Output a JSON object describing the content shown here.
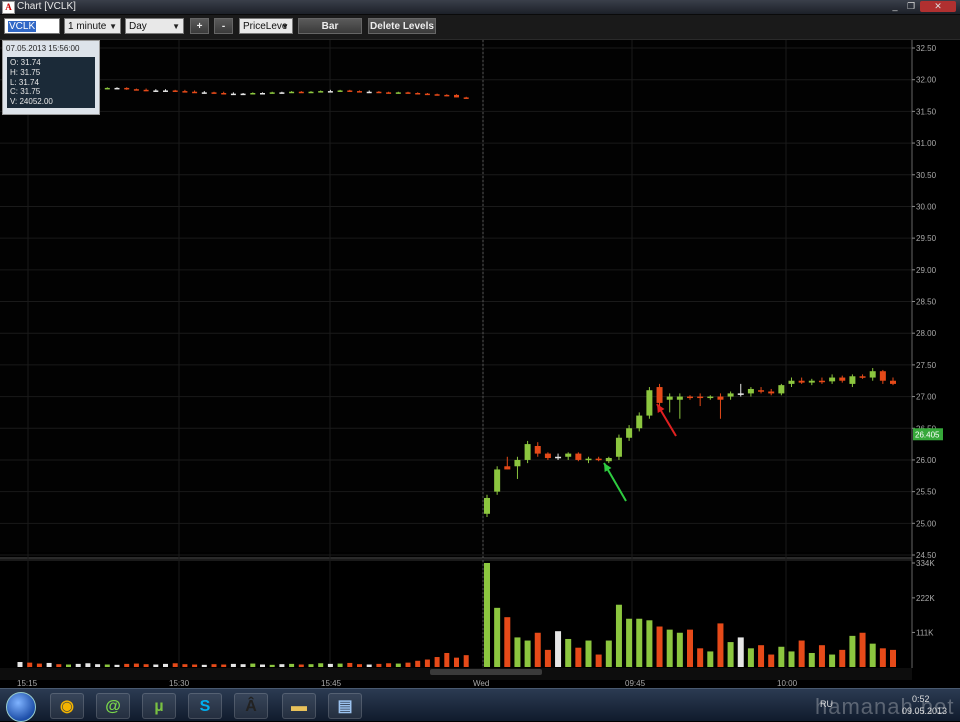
{
  "window": {
    "title": "Chart [VCLK]",
    "minimize": "_",
    "restore": "❐",
    "close": "✕"
  },
  "toolbar": {
    "symbol": "VCLK",
    "interval": "1 minute",
    "period": "Day",
    "zoom_in": "+",
    "zoom_out": "-",
    "study": "PriceLeve",
    "bar_button": "Bar",
    "delete_levels_button": "Delete Levels"
  },
  "ohlc_panel": {
    "timestamp": "07.05.2013 15:56:00",
    "open": "O: 31.74",
    "high": "H: 31.75",
    "low": "L: 31.74",
    "close": "C: 31.75",
    "volume": "V: 24052.00"
  },
  "colors": {
    "up": "#8cc63f",
    "down": "#e64a19",
    "neutral": "#e6e6e6",
    "last_price_bg": "#36a83a",
    "grid": "#1a1a1a"
  },
  "chart_data": {
    "type": "candlestick",
    "price_axis": {
      "range": [
        24.5,
        32.5
      ],
      "ticks": [
        "32.50",
        "32.00",
        "31.50",
        "31.00",
        "30.50",
        "30.00",
        "29.50",
        "29.00",
        "28.50",
        "28.00",
        "27.50",
        "27.00",
        "26.50",
        "26.00",
        "25.50",
        "25.00",
        "24.50"
      ]
    },
    "last_price": "26.405",
    "volume_axis": {
      "max": 334,
      "ticks": [
        "334K",
        "222K",
        "111K"
      ]
    },
    "time_axis": {
      "labels": [
        "15:15",
        "15:30",
        "15:45",
        "Wed",
        "09:45",
        "10:00"
      ]
    },
    "candles_day1": [
      {
        "o": 31.88,
        "h": 31.9,
        "l": 31.86,
        "c": 31.88,
        "v": 16
      },
      {
        "o": 31.88,
        "h": 31.9,
        "l": 31.86,
        "c": 31.87,
        "v": 14
      },
      {
        "o": 31.87,
        "h": 31.89,
        "l": 31.85,
        "c": 31.86,
        "v": 11
      },
      {
        "o": 31.86,
        "h": 31.88,
        "l": 31.84,
        "c": 31.86,
        "v": 13
      },
      {
        "o": 31.86,
        "h": 31.88,
        "l": 31.84,
        "c": 31.85,
        "v": 9
      },
      {
        "o": 31.85,
        "h": 31.87,
        "l": 31.83,
        "c": 31.86,
        "v": 8
      },
      {
        "o": 31.86,
        "h": 31.88,
        "l": 31.84,
        "c": 31.86,
        "v": 10
      },
      {
        "o": 31.86,
        "h": 31.88,
        "l": 31.84,
        "c": 31.86,
        "v": 12
      },
      {
        "o": 31.86,
        "h": 31.88,
        "l": 31.84,
        "c": 31.86,
        "v": 9
      },
      {
        "o": 31.86,
        "h": 31.88,
        "l": 31.85,
        "c": 31.87,
        "v": 8
      },
      {
        "o": 31.87,
        "h": 31.88,
        "l": 31.86,
        "c": 31.87,
        "v": 7
      },
      {
        "o": 31.87,
        "h": 31.88,
        "l": 31.84,
        "c": 31.85,
        "v": 10
      },
      {
        "o": 31.85,
        "h": 31.86,
        "l": 31.83,
        "c": 31.84,
        "v": 11
      },
      {
        "o": 31.84,
        "h": 31.86,
        "l": 31.82,
        "c": 31.83,
        "v": 9
      },
      {
        "o": 31.83,
        "h": 31.85,
        "l": 31.81,
        "c": 31.83,
        "v": 8
      },
      {
        "o": 31.83,
        "h": 31.85,
        "l": 31.81,
        "c": 31.83,
        "v": 10
      },
      {
        "o": 31.83,
        "h": 31.84,
        "l": 31.81,
        "c": 31.82,
        "v": 12
      },
      {
        "o": 31.82,
        "h": 31.84,
        "l": 31.8,
        "c": 31.81,
        "v": 9
      },
      {
        "o": 31.81,
        "h": 31.83,
        "l": 31.79,
        "c": 31.8,
        "v": 8
      },
      {
        "o": 31.8,
        "h": 31.82,
        "l": 31.78,
        "c": 31.8,
        "v": 7
      },
      {
        "o": 31.8,
        "h": 31.81,
        "l": 31.78,
        "c": 31.79,
        "v": 9
      },
      {
        "o": 31.79,
        "h": 31.81,
        "l": 31.77,
        "c": 31.78,
        "v": 8
      },
      {
        "o": 31.78,
        "h": 31.8,
        "l": 31.77,
        "c": 31.78,
        "v": 10
      },
      {
        "o": 31.78,
        "h": 31.79,
        "l": 31.76,
        "c": 31.78,
        "v": 9
      },
      {
        "o": 31.78,
        "h": 31.8,
        "l": 31.77,
        "c": 31.79,
        "v": 11
      },
      {
        "o": 31.79,
        "h": 31.8,
        "l": 31.77,
        "c": 31.79,
        "v": 8
      },
      {
        "o": 31.79,
        "h": 31.81,
        "l": 31.78,
        "c": 31.8,
        "v": 7
      },
      {
        "o": 31.8,
        "h": 31.81,
        "l": 31.78,
        "c": 31.8,
        "v": 9
      },
      {
        "o": 31.8,
        "h": 31.82,
        "l": 31.79,
        "c": 31.81,
        "v": 10
      },
      {
        "o": 31.81,
        "h": 31.82,
        "l": 31.79,
        "c": 31.8,
        "v": 8
      },
      {
        "o": 31.8,
        "h": 31.82,
        "l": 31.79,
        "c": 31.81,
        "v": 9
      },
      {
        "o": 31.81,
        "h": 31.83,
        "l": 31.8,
        "c": 31.82,
        "v": 12
      },
      {
        "o": 31.82,
        "h": 31.84,
        "l": 31.8,
        "c": 31.82,
        "v": 10
      },
      {
        "o": 31.82,
        "h": 31.84,
        "l": 31.81,
        "c": 31.83,
        "v": 11
      },
      {
        "o": 31.83,
        "h": 31.84,
        "l": 31.81,
        "c": 31.82,
        "v": 13
      },
      {
        "o": 31.82,
        "h": 31.83,
        "l": 31.8,
        "c": 31.81,
        "v": 9
      },
      {
        "o": 31.81,
        "h": 31.83,
        "l": 31.8,
        "c": 31.81,
        "v": 8
      },
      {
        "o": 31.81,
        "h": 31.82,
        "l": 31.79,
        "c": 31.8,
        "v": 10
      },
      {
        "o": 31.8,
        "h": 31.81,
        "l": 31.78,
        "c": 31.79,
        "v": 12
      },
      {
        "o": 31.79,
        "h": 31.81,
        "l": 31.78,
        "c": 31.8,
        "v": 11
      },
      {
        "o": 31.8,
        "h": 31.81,
        "l": 31.78,
        "c": 31.79,
        "v": 14
      },
      {
        "o": 31.79,
        "h": 31.8,
        "l": 31.77,
        "c": 31.78,
        "v": 20
      },
      {
        "o": 31.78,
        "h": 31.79,
        "l": 31.76,
        "c": 31.77,
        "v": 24
      },
      {
        "o": 31.77,
        "h": 31.78,
        "l": 31.75,
        "c": 31.76,
        "v": 32
      },
      {
        "o": 31.76,
        "h": 31.77,
        "l": 31.74,
        "c": 31.75,
        "v": 45
      },
      {
        "o": 31.76,
        "h": 31.77,
        "l": 31.72,
        "c": 31.72,
        "v": 30
      },
      {
        "o": 31.72,
        "h": 31.73,
        "l": 31.7,
        "c": 31.71,
        "v": 38
      }
    ],
    "candles_day2": [
      {
        "o": 25.15,
        "h": 25.45,
        "l": 25.1,
        "c": 25.4,
        "v": 334
      },
      {
        "o": 25.5,
        "h": 25.9,
        "l": 25.45,
        "c": 25.85,
        "v": 190
      },
      {
        "o": 25.9,
        "h": 26.05,
        "l": 25.85,
        "c": 25.85,
        "v": 160
      },
      {
        "o": 25.9,
        "h": 26.05,
        "l": 25.7,
        "c": 26.0,
        "v": 95
      },
      {
        "o": 26.0,
        "h": 26.3,
        "l": 25.95,
        "c": 26.25,
        "v": 85
      },
      {
        "o": 26.22,
        "h": 26.28,
        "l": 26.05,
        "c": 26.1,
        "v": 110
      },
      {
        "o": 26.1,
        "h": 26.12,
        "l": 26.0,
        "c": 26.03,
        "v": 55
      },
      {
        "o": 26.05,
        "h": 26.1,
        "l": 26.0,
        "c": 26.05,
        "v": 115
      },
      {
        "o": 26.05,
        "h": 26.12,
        "l": 26.0,
        "c": 26.1,
        "v": 90
      },
      {
        "o": 26.1,
        "h": 26.12,
        "l": 25.98,
        "c": 26.0,
        "v": 62
      },
      {
        "o": 26.0,
        "h": 26.05,
        "l": 25.95,
        "c": 26.02,
        "v": 85
      },
      {
        "o": 26.02,
        "h": 26.05,
        "l": 25.98,
        "c": 26.0,
        "v": 40
      },
      {
        "o": 25.98,
        "h": 26.05,
        "l": 25.95,
        "c": 26.03,
        "v": 85
      },
      {
        "o": 26.05,
        "h": 26.4,
        "l": 26.0,
        "c": 26.35,
        "v": 200
      },
      {
        "o": 26.35,
        "h": 26.55,
        "l": 26.3,
        "c": 26.5,
        "v": 155
      },
      {
        "o": 26.5,
        "h": 26.75,
        "l": 26.45,
        "c": 26.7,
        "v": 155
      },
      {
        "o": 26.7,
        "h": 27.15,
        "l": 26.65,
        "c": 27.1,
        "v": 150
      },
      {
        "o": 27.15,
        "h": 27.2,
        "l": 26.85,
        "c": 26.9,
        "v": 130
      },
      {
        "o": 26.95,
        "h": 27.05,
        "l": 26.75,
        "c": 27.0,
        "v": 120
      },
      {
        "o": 26.95,
        "h": 27.05,
        "l": 26.65,
        "c": 27.0,
        "v": 110
      },
      {
        "o": 27.0,
        "h": 27.02,
        "l": 26.95,
        "c": 26.98,
        "v": 120
      },
      {
        "o": 27.0,
        "h": 27.05,
        "l": 26.85,
        "c": 26.98,
        "v": 60
      },
      {
        "o": 26.98,
        "h": 27.02,
        "l": 26.95,
        "c": 27.0,
        "v": 50
      },
      {
        "o": 27.0,
        "h": 27.05,
        "l": 26.65,
        "c": 26.95,
        "v": 140
      },
      {
        "o": 27.0,
        "h": 27.08,
        "l": 26.95,
        "c": 27.05,
        "v": 80
      },
      {
        "o": 27.05,
        "h": 27.2,
        "l": 27.0,
        "c": 27.05,
        "v": 95
      },
      {
        "o": 27.05,
        "h": 27.15,
        "l": 27.0,
        "c": 27.12,
        "v": 60
      },
      {
        "o": 27.1,
        "h": 27.15,
        "l": 27.05,
        "c": 27.08,
        "v": 70
      },
      {
        "o": 27.08,
        "h": 27.12,
        "l": 27.02,
        "c": 27.05,
        "v": 40
      },
      {
        "o": 27.05,
        "h": 27.2,
        "l": 27.02,
        "c": 27.18,
        "v": 65
      },
      {
        "o": 27.2,
        "h": 27.3,
        "l": 27.15,
        "c": 27.25,
        "v": 50
      },
      {
        "o": 27.25,
        "h": 27.3,
        "l": 27.2,
        "c": 27.22,
        "v": 85
      },
      {
        "o": 27.22,
        "h": 27.28,
        "l": 27.18,
        "c": 27.25,
        "v": 45
      },
      {
        "o": 27.25,
        "h": 27.3,
        "l": 27.2,
        "c": 27.24,
        "v": 70
      },
      {
        "o": 27.24,
        "h": 27.35,
        "l": 27.2,
        "c": 27.3,
        "v": 40
      },
      {
        "o": 27.3,
        "h": 27.33,
        "l": 27.22,
        "c": 27.25,
        "v": 55
      },
      {
        "o": 27.2,
        "h": 27.35,
        "l": 27.15,
        "c": 27.32,
        "v": 100
      },
      {
        "o": 27.32,
        "h": 27.35,
        "l": 27.28,
        "c": 27.3,
        "v": 110
      },
      {
        "o": 27.3,
        "h": 27.45,
        "l": 27.25,
        "c": 27.4,
        "v": 75
      },
      {
        "o": 27.4,
        "h": 27.42,
        "l": 27.2,
        "c": 27.25,
        "v": 60
      },
      {
        "o": 27.25,
        "h": 27.3,
        "l": 27.18,
        "c": 27.2,
        "v": 55
      }
    ]
  },
  "taskbar": {
    "apps": [
      {
        "name": "chrome-icon",
        "glyph": "◉",
        "color": "#f4b400"
      },
      {
        "name": "mail-agent-icon",
        "glyph": "@",
        "color": "#7ad84a"
      },
      {
        "name": "utorrent-icon",
        "glyph": "µ",
        "color": "#79c142"
      },
      {
        "name": "skype-icon",
        "glyph": "S",
        "color": "#00aff0"
      },
      {
        "name": "app-a-icon",
        "glyph": "Â",
        "color": "#222"
      },
      {
        "name": "folder-icon",
        "glyph": "▬",
        "color": "#e8c15a"
      },
      {
        "name": "book-icon",
        "glyph": "▤",
        "color": "#9cc3f0"
      }
    ],
    "lang": "RU",
    "time": "0:52",
    "date": "09.05.2013"
  },
  "watermark": "hamanah.net"
}
